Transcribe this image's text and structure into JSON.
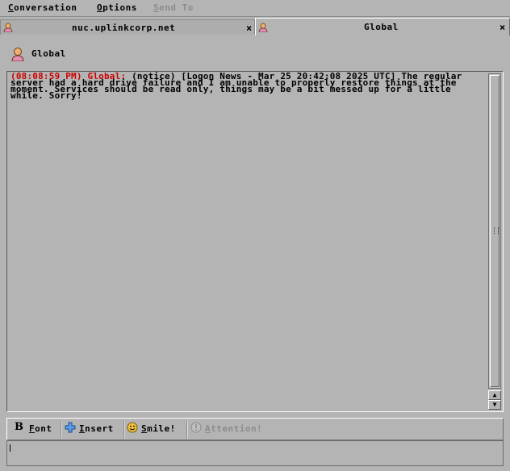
{
  "menubar": {
    "items": [
      {
        "label": "Conversation",
        "mnemonic": "C",
        "rest": "onversation",
        "disabled": false
      },
      {
        "label": "Options",
        "mnemonic": "O",
        "rest": "ptions",
        "disabled": false
      },
      {
        "label": "Send To",
        "mnemonic": "S",
        "rest": "end To",
        "disabled": true
      }
    ]
  },
  "tabs": [
    {
      "label": "nuc.uplinkcorp.net",
      "close": "×",
      "active": false
    },
    {
      "label": "Global",
      "close": "×",
      "active": true
    }
  ],
  "header": {
    "name": "Global"
  },
  "log": {
    "messages": [
      {
        "timestamp": "(08:08:59 PM) Global:",
        "text": " (notice) [Logon News - Mar 25 20:42:08 2025 UTC] The regular server had a hard drive failure and I am unable to properly restore things at the moment. Services should be read only, things may be a bit messed up for a little while. Sorry!"
      }
    ]
  },
  "toolbar": {
    "font": {
      "mnemonic": "F",
      "rest": "ont",
      "icon": "bold-B-icon"
    },
    "insert": {
      "mnemonic": "I",
      "rest": "nsert",
      "icon": "plus-icon"
    },
    "smile": {
      "mnemonic": "S",
      "rest": "mile!",
      "icon": "smiley-icon"
    },
    "attention": {
      "mnemonic": "A",
      "rest": "ttention!",
      "icon": "attention-icon",
      "disabled": true
    }
  },
  "colors": {
    "timestamp": "#cc0000",
    "background": "#b4b4b4",
    "disabled": "#8c8c8c"
  }
}
